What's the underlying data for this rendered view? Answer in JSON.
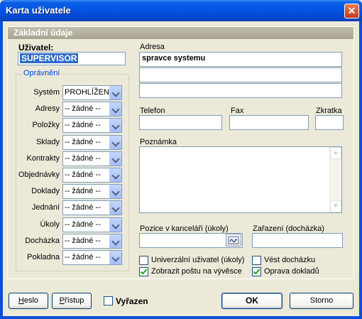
{
  "window": {
    "title": "Karta uživatele",
    "close_symbol": "✕"
  },
  "section": {
    "title": "Základní údaje"
  },
  "user": {
    "label": "Uživatel:",
    "value": "SUPERVISOR"
  },
  "permissions": {
    "legend": "Oprávnění",
    "items": [
      {
        "label": "Systém",
        "value": "PROHLÍŽEN"
      },
      {
        "label": "Adresy",
        "value": "-- žádné --"
      },
      {
        "label": "Položky",
        "value": "-- žádné --"
      },
      {
        "label": "Sklady",
        "value": "-- žádné --"
      },
      {
        "label": "Kontrakty",
        "value": "-- žádné --"
      },
      {
        "label": "Objednávky",
        "value": "-- žádné --"
      },
      {
        "label": "Doklady",
        "value": "-- žádné --"
      },
      {
        "label": "Jednání",
        "value": "-- žádné --"
      },
      {
        "label": "Úkoly",
        "value": "-- žádné --"
      },
      {
        "label": "Docházka",
        "value": "-- žádné --"
      },
      {
        "label": "Pokladna",
        "value": "-- žádné --"
      }
    ]
  },
  "address": {
    "label": "Adresa",
    "line1": "spravce systemu",
    "line2": "",
    "line3": ""
  },
  "contact": {
    "phone_label": "Telefon",
    "phone": "",
    "fax_label": "Fax",
    "fax": "",
    "abbr_label": "Zkratka",
    "abbr": ""
  },
  "note": {
    "label": "Poznámka",
    "value": ""
  },
  "position": {
    "label": "Pozice v kanceláři (úkoly)",
    "value": ""
  },
  "attendance_group": {
    "label": "Zařazení (docházka)",
    "value": ""
  },
  "options": {
    "universal_user": {
      "label": "Univerzální uživatel (úkoly)",
      "checked": false
    },
    "show_mail": {
      "label": "Zobrazit poštu na vývěsce",
      "checked": true
    },
    "keep_attendance": {
      "label": "Vést docházku",
      "checked": false
    },
    "doc_correction": {
      "label": "Oprava dokladů",
      "checked": true
    }
  },
  "footer": {
    "password_label": "Heslo",
    "access_label": "Přístup",
    "excluded_label": "Vyřazen",
    "excluded_checked": false,
    "ok_label": "OK",
    "cancel_label": "Storno"
  }
}
